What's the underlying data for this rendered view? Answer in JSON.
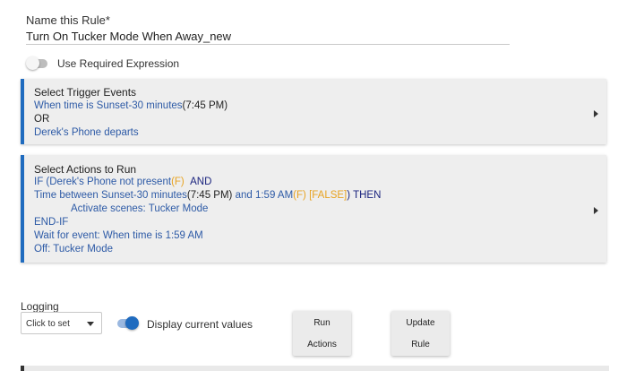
{
  "rule_name": {
    "label": "Name this Rule*",
    "value": "Turn On Tucker Mode When Away_new"
  },
  "required_expression": {
    "label": "Use Required Expression",
    "enabled": false
  },
  "trigger_panel": {
    "title": "Select Trigger Events",
    "line1": {
      "text": "When time is Sunset-30 minutes",
      "time": "(7:45 PM)"
    },
    "or": "OR",
    "line3": "Derek's Phone departs"
  },
  "actions_panel": {
    "title": "Select Actions to Run",
    "if_line": {
      "part1": "IF (Derek's Phone not present",
      "flag": "(F)",
      "and": "AND"
    },
    "time_line": {
      "part1": "Time between Sunset-30 minutes",
      "time1": "(7:45 PM)",
      "part2": " and 1:59 AM",
      "flag": "(F)",
      "false_flag": "[FALSE]",
      "then": ") THEN"
    },
    "activate": "Activate scenes: Tucker Mode",
    "end_if": "END-IF",
    "wait": "Wait for event: When time is 1:59 AM",
    "off": "Off: Tucker Mode"
  },
  "logging": {
    "label": "Logging",
    "select_value": "Click to set"
  },
  "display_values": {
    "label": "Display current values",
    "enabled": true
  },
  "buttons": {
    "run_line1": "Run",
    "run_line2": "Actions",
    "update_line1": "Update",
    "update_line2": "Rule"
  },
  "colors": {
    "accent": "#1f6bbf",
    "link_blue": "#2d5aa6",
    "flag_orange": "#e8a321",
    "panel_bg": "#eeeeee"
  },
  "icons": {
    "panel_expand": "caret-right-icon",
    "select_dropdown": "caret-down-icon"
  }
}
